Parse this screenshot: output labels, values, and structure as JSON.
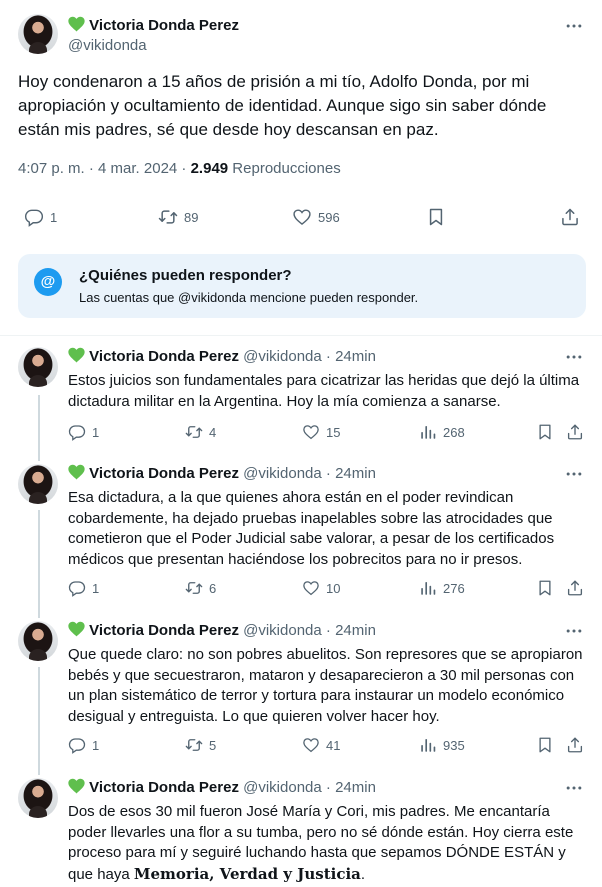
{
  "main": {
    "display_name": "Victoria Donda Perez",
    "handle": "@vikidonda",
    "text": "Hoy condenaron a 15 años de prisión a mi tío, Adolfo Donda, por mi apropiación y ocultamiento de identidad. Aunque sigo sin saber dónde están mis padres, sé que desde hoy descansan en paz.",
    "time": "4:07 p. m. · 4 mar. 2024 · ",
    "views": "2.949",
    "views_label": " Reproducciones",
    "replies": "1",
    "retweets": "89",
    "likes": "596"
  },
  "reply_restriction": {
    "icon": "@",
    "title": "¿Quiénes pueden responder?",
    "subtitle": "Las cuentas que @vikidonda mencione pueden responder."
  },
  "thread": [
    {
      "display_name": "Victoria Donda Perez",
      "handle": "@vikidonda",
      "time": "· 24min",
      "text": "Estos juicios son fundamentales para cicatrizar las heridas que dejó la última dictadura militar en la Argentina. Hoy la mía comienza a sanarse.",
      "replies": "1",
      "retweets": "4",
      "likes": "15",
      "views": "268"
    },
    {
      "display_name": "Victoria Donda Perez",
      "handle": "@vikidonda",
      "time": "· 24min",
      "text": "Esa dictadura, a la que quienes ahora están en el poder revindican cobardemente, ha dejado pruebas inapelables sobre las atrocidades que cometieron que el Poder Judicial sabe valorar, a pesar de los certificados médicos que presentan haciéndose los pobrecitos para no ir presos.",
      "replies": "1",
      "retweets": "6",
      "likes": "10",
      "views": "276"
    },
    {
      "display_name": "Victoria Donda Perez",
      "handle": "@vikidonda",
      "time": "· 24min",
      "text": "Que quede claro: no son pobres abuelitos. Son represores que se apropiaron bebés y que secuestraron, mataron y desaparecieron a 30 mil personas con un plan sistemático de terror y tortura para instaurar un modelo económico desigual y entreguista. Lo que quieren volver hacer hoy.",
      "replies": "1",
      "retweets": "5",
      "likes": "41",
      "views": "935"
    },
    {
      "display_name": "Victoria Donda Perez",
      "handle": "@vikidonda",
      "time": "· 24min",
      "text": "Dos de esos 30 mil fueron José María y Cori, mis padres. Me encantaría poder llevarles una flor a su tumba, pero no sé dónde están. Hoy cierra este proceso para mí y seguiré luchando hasta que sepamos DÓNDE ESTÁN y que haya ",
      "text_bold": "Memoria, Verdad y Justicia",
      "text_end": "."
    }
  ],
  "icons": {
    "verified_heart": "green-heart-icon",
    "more": "more-icon",
    "reply": "reply-icon",
    "retweet": "retweet-icon",
    "like": "like-icon",
    "views": "views-icon",
    "bookmark": "bookmark-icon",
    "share": "share-icon"
  },
  "colors": {
    "text": "#0f1419",
    "muted": "#536471",
    "accent": "#1d9bf0",
    "heart": "#5fbf4d",
    "reply_box_bg": "#eaf3fb"
  }
}
